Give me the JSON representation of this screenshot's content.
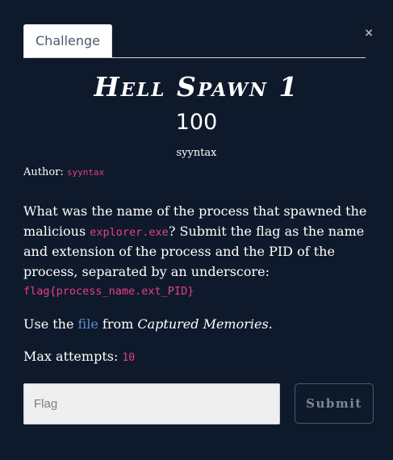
{
  "modal": {
    "close_label": "×"
  },
  "tabs": [
    {
      "label": "Challenge"
    }
  ],
  "challenge": {
    "name": "Hell Spawn 1",
    "points": "100",
    "author_name": "syyntax",
    "author_label": "Author:",
    "author_code": "syyntax",
    "description": {
      "part1": "What was the name of the process that spawned the malicious ",
      "code_process": "explorer.exe",
      "part2": "? Submit the flag as the name and extension of the process and the PID of the process, separated by an underscore:",
      "flag_format": "flag{process_name.ext_PID}"
    },
    "use_line": {
      "prefix": "Use the ",
      "link_text": "file",
      "middle": " from ",
      "source": "Captured Memories",
      "suffix": "."
    },
    "attempts": {
      "label": "Max attempts:",
      "value": "10"
    }
  },
  "form": {
    "flag_placeholder": "Flag",
    "flag_value": "",
    "submit_label": "Submit"
  },
  "colors": {
    "background": "#0e1a2b",
    "code": "#e83e8c",
    "link": "#5b8ed6"
  }
}
